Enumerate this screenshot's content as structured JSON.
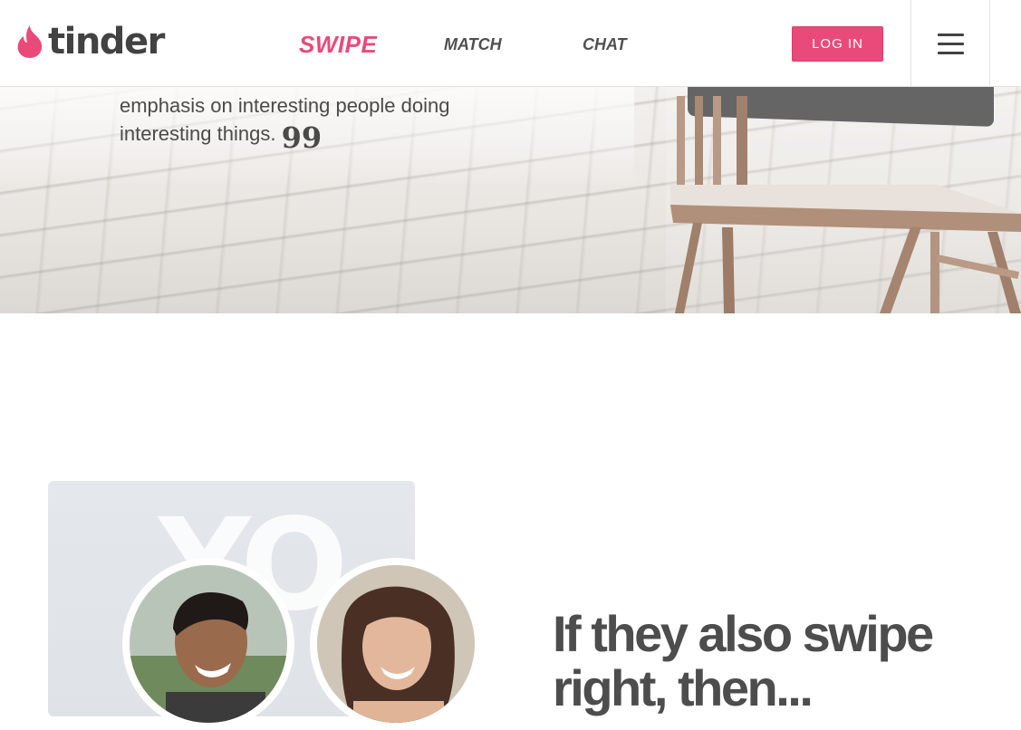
{
  "brand": {
    "name": "tinder",
    "flame_color": "#ea4a79"
  },
  "nav": {
    "swipe": "SWIPE",
    "match": "MATCH",
    "chat": "CHAT"
  },
  "header": {
    "login_label": "LOG IN",
    "menu_icon": "hamburger-menu-icon"
  },
  "hero": {
    "quote_text": "emphasis on interesting people doing interesting things.",
    "quote_mark": "99"
  },
  "section": {
    "bg_letters": "YO",
    "headline": "If they also swipe right, then..."
  },
  "colors": {
    "accent": "#ea4a79",
    "text": "#4d4d4d"
  }
}
